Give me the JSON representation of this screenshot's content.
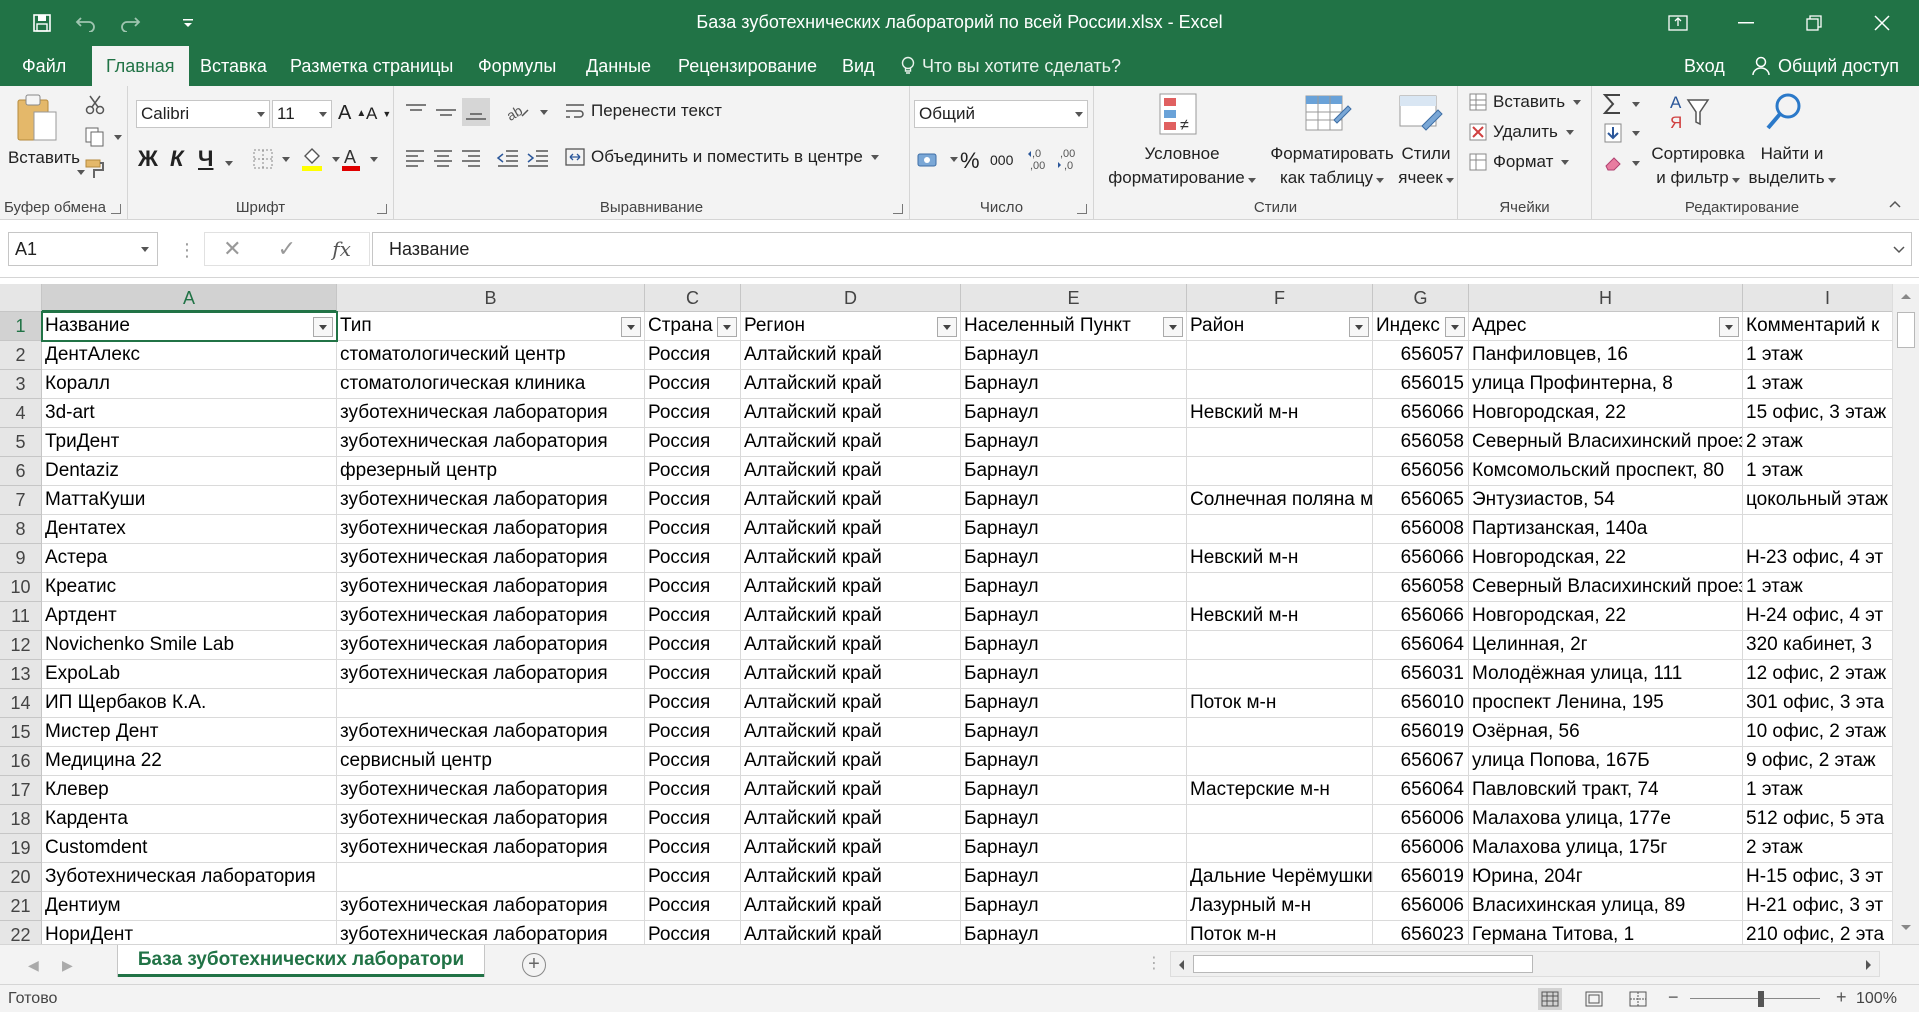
{
  "window": {
    "title": "База зуботехнических лабораторий по всей России.xlsx - Excel"
  },
  "tabs": [
    "Файл",
    "Главная",
    "Вставка",
    "Разметка страницы",
    "Формулы",
    "Данные",
    "Рецензирование",
    "Вид"
  ],
  "tell_me": "Что вы хотите сделать?",
  "login": "Вход",
  "share": "Общий доступ",
  "ribbon": {
    "clipboard": {
      "label": "Буфер обмена",
      "paste": "Вставить"
    },
    "font": {
      "label": "Шрифт",
      "family": "Calibri",
      "size": "11",
      "bold": "Ж",
      "italic": "К",
      "underline": "Ч"
    },
    "alignment": {
      "label": "Выравнивание",
      "wrap": "Перенести текст",
      "merge": "Объединить и поместить в центре"
    },
    "number": {
      "label": "Число",
      "format": "Общий",
      "percent": "%",
      "thousands": "000"
    },
    "styles": {
      "label": "Стили",
      "conditional_1": "Условное",
      "conditional_2": "форматирование",
      "as_table_1": "Форматировать",
      "as_table_2": "как таблицу",
      "cell_styles_1": "Стили",
      "cell_styles_2": "ячеек"
    },
    "cells": {
      "label": "Ячейки",
      "insert": "Вставить",
      "delete": "Удалить",
      "format": "Формат"
    },
    "editing": {
      "label": "Редактирование",
      "sort_1": "Сортировка",
      "sort_2": "и фильтр",
      "find_1": "Найти и",
      "find_2": "выделить"
    }
  },
  "formula_bar": {
    "name_box": "A1",
    "fx": "fx",
    "formula": "Название"
  },
  "columns": [
    "A",
    "B",
    "C",
    "D",
    "E",
    "F",
    "G",
    "H",
    "I"
  ],
  "headers": [
    "Название",
    "Тип",
    "Страна",
    "Регион",
    "Населенный Пункт",
    "Район",
    "Индекс",
    "Адрес",
    "Комментарий к"
  ],
  "rows": [
    [
      "ДентАлекс",
      "стоматологический центр",
      "Россия",
      "Алтайский край",
      "Барнаул",
      "",
      "656057",
      "Панфиловцев, 16",
      "1 этаж"
    ],
    [
      "Коралл",
      "стоматологическая клиника",
      "Россия",
      "Алтайский край",
      "Барнаул",
      "",
      "656015",
      "улица Профинтерна, 8",
      "1 этаж"
    ],
    [
      "3d-art",
      "зуботехническая лаборатория",
      "Россия",
      "Алтайский край",
      "Барнаул",
      "Невский м-н",
      "656066",
      "Новгородская, 22",
      "15 офис, 3 этаж"
    ],
    [
      "ТриДент",
      "зуботехническая лаборатория",
      "Россия",
      "Алтайский край",
      "Барнаул",
      "",
      "656058",
      "Северный Власихинский проезд",
      "2 этаж"
    ],
    [
      "Dentaziz",
      "фрезерный центр",
      "Россия",
      "Алтайский край",
      "Барнаул",
      "",
      "656056",
      "Комсомольский проспект, 80",
      "1 этаж"
    ],
    [
      "МаттаКуши",
      "зуботехническая лаборатория",
      "Россия",
      "Алтайский край",
      "Барнаул",
      "Солнечная поляна м-н",
      "656065",
      "Энтузиастов, 54",
      "цокольный этаж"
    ],
    [
      "Дентатех",
      "зуботехническая лаборатория",
      "Россия",
      "Алтайский край",
      "Барнаул",
      "",
      "656008",
      "Партизанская, 140а",
      ""
    ],
    [
      "Астера",
      "зуботехническая лаборатория",
      "Россия",
      "Алтайский край",
      "Барнаул",
      "Невский м-н",
      "656066",
      "Новгородская, 22",
      "Н-23 офис, 4 эт"
    ],
    [
      "Креатис",
      "зуботехническая лаборатория",
      "Россия",
      "Алтайский край",
      "Барнаул",
      "",
      "656058",
      "Северный Власихинский проезд",
      "1 этаж"
    ],
    [
      "Артдент",
      "зуботехническая лаборатория",
      "Россия",
      "Алтайский край",
      "Барнаул",
      "Невский м-н",
      "656066",
      "Новгородская, 22",
      "Н-24 офис, 4 эт"
    ],
    [
      "Novichenko Smile Lab",
      "зуботехническая лаборатория",
      "Россия",
      "Алтайский край",
      "Барнаул",
      "",
      "656064",
      "Целинная, 2г",
      "320 кабинет, 3"
    ],
    [
      "ExpoLab",
      "зуботехническая лаборатория",
      "Россия",
      "Алтайский край",
      "Барнаул",
      "",
      "656031",
      "Молодёжная улица, 111",
      "12 офис, 2 этаж"
    ],
    [
      "ИП Щербаков К.А.",
      "",
      "Россия",
      "Алтайский край",
      "Барнаул",
      "Поток м-н",
      "656010",
      "проспект Ленина, 195",
      "301 офис, 3 эта"
    ],
    [
      "Мистер Дент",
      "зуботехническая лаборатория",
      "Россия",
      "Алтайский край",
      "Барнаул",
      "",
      "656019",
      "Озёрная, 56",
      "10 офис, 2 этаж"
    ],
    [
      "Медицина 22",
      "сервисный центр",
      "Россия",
      "Алтайский край",
      "Барнаул",
      "",
      "656067",
      "улица Попова, 167Б",
      "9 офис, 2 этаж"
    ],
    [
      "Клевер",
      "зуботехническая лаборатория",
      "Россия",
      "Алтайский край",
      "Барнаул",
      "Мастерские м-н",
      "656064",
      "Павловский тракт, 74",
      "1 этаж"
    ],
    [
      "Кардента",
      "зуботехническая лаборатория",
      "Россия",
      "Алтайский край",
      "Барнаул",
      "",
      "656006",
      "Малахова улица, 177е",
      "512 офис, 5 эта"
    ],
    [
      "Customdent",
      "зуботехническая лаборатория",
      "Россия",
      "Алтайский край",
      "Барнаул",
      "",
      "656006",
      "Малахова улица, 175г",
      "2 этаж"
    ],
    [
      "Зуботехническая лаборатория",
      "",
      "Россия",
      "Алтайский край",
      "Барнаул",
      "Дальние Черёмушки",
      "656019",
      "Юрина, 204г",
      "Н-15 офис, 3 эт"
    ],
    [
      "Дентиум",
      "зуботехническая лаборатория",
      "Россия",
      "Алтайский край",
      "Барнаул",
      "Лазурный м-н",
      "656006",
      "Власихинская улица, 89",
      "Н-21 офис, 3 эт"
    ],
    [
      "НориДент",
      "зуботехническая лаборатория",
      "Россия",
      "Алтайский край",
      "Барнаул",
      "Поток м-н",
      "656023",
      "Германа Титова, 1",
      "210 офис, 2 эта"
    ]
  ],
  "sheet_tab": "База зуботехнических лаборатори",
  "status": {
    "ready": "Готово",
    "zoom": "100%"
  }
}
